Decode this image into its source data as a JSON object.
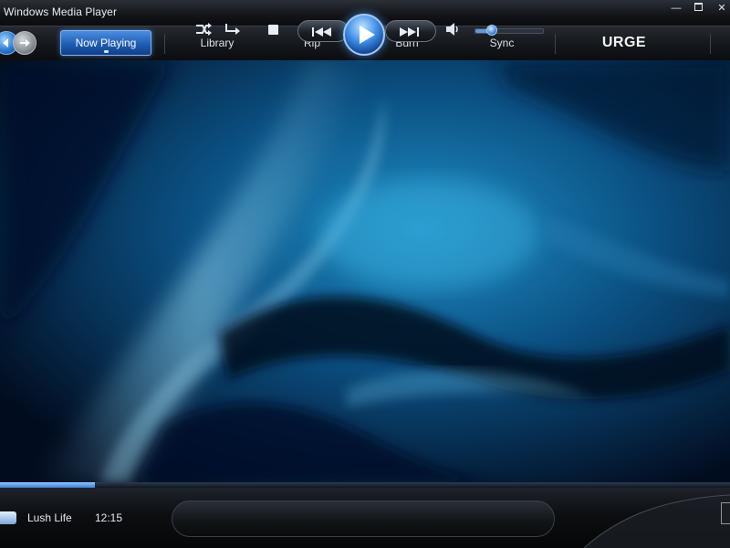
{
  "window": {
    "title": "Windows Media Player",
    "buttons": {
      "minimize": "minimize-icon",
      "maximize": "maximize-icon",
      "close": "close-icon"
    }
  },
  "nav": {
    "back_icon": "back-arrow-icon",
    "forward_icon": "forward-arrow-icon",
    "tabs": [
      {
        "label": "Now Playing",
        "active": true
      },
      {
        "label": "Library",
        "active": false
      },
      {
        "label": "Rip",
        "active": false
      },
      {
        "label": "Burn",
        "active": false
      },
      {
        "label": "Sync",
        "active": false
      }
    ],
    "store": "URGE"
  },
  "player": {
    "track": "Lush Life",
    "time": "12:15",
    "seek_progress": 0.13,
    "volume": 0.25,
    "controls": [
      "shuffle-icon",
      "repeat-icon",
      "stop-icon",
      "previous-icon",
      "play-icon",
      "next-icon",
      "speaker-icon"
    ]
  },
  "colors": {
    "accent": "#3d8ce6",
    "chrome": "#121418",
    "visualization": "#0a3a6a"
  }
}
